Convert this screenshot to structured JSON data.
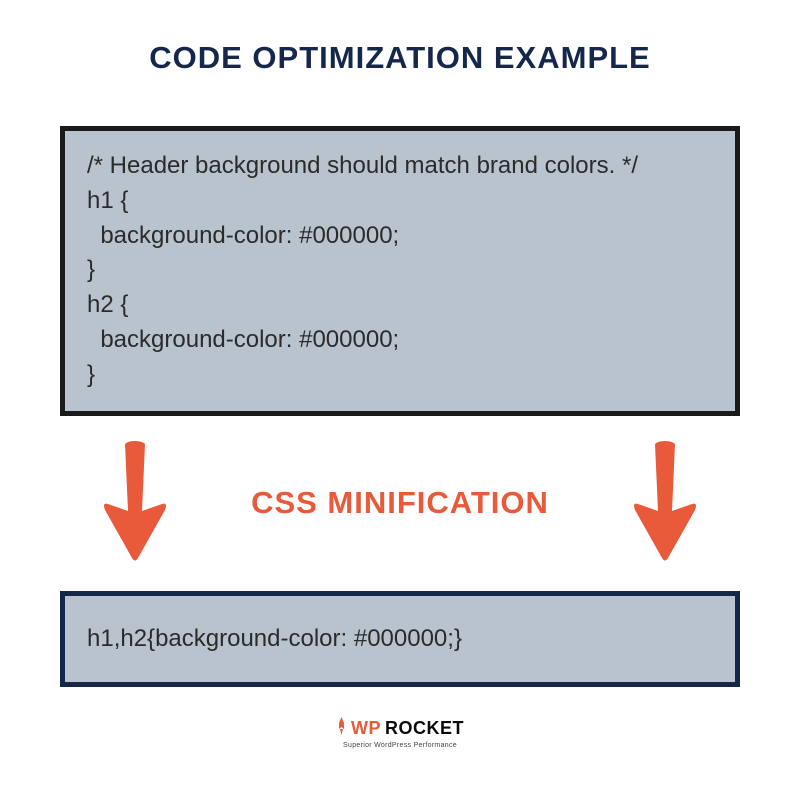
{
  "title": "CODE OPTIMIZATION EXAMPLE",
  "before_code": "/* Header background should match brand colors. */\nh1 {\n  background-color: #000000;\n}\nh2 {\n  background-color: #000000;\n}",
  "process_label": "CSS MINIFICATION",
  "after_code": "h1,h2{background-color: #000000;}",
  "logo": {
    "wp": "WP",
    "rocket": "ROCKET",
    "tagline": "Superior WordPress Performance"
  },
  "colors": {
    "navy": "#16274c",
    "orange": "#e85a3a",
    "box_bg": "#b9c3ce"
  }
}
